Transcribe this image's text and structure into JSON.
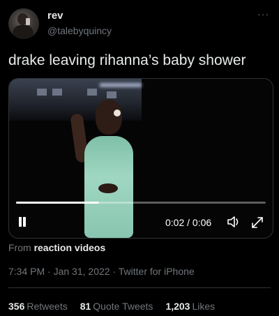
{
  "author": {
    "name": "rev",
    "handle": "@talebyquincy",
    "more_label": "···"
  },
  "tweet": {
    "text": "drake leaving rihanna’s baby shower"
  },
  "video": {
    "time_label": "0:02 / 0:06",
    "progress": 0.333,
    "pause_icon": "pause-icon",
    "volume_icon": "volume-icon",
    "expand_icon": "expand-icon"
  },
  "source": {
    "prefix": "From",
    "name": "reaction videos"
  },
  "meta": {
    "time": "7:34 PM",
    "sep1": " · ",
    "date": "Jan 31, 2022",
    "sep2": " · ",
    "client": "Twitter for iPhone"
  },
  "stats": {
    "retweets_count": "356",
    "retweets_label": "Retweets",
    "quotes_count": "81",
    "quotes_label": "Quote Tweets",
    "likes_count": "1,203",
    "likes_label": "Likes"
  },
  "colors": {
    "background": "#000000",
    "text_primary": "#e7e9ea",
    "text_secondary": "#71767b",
    "divider": "#2f3336"
  }
}
